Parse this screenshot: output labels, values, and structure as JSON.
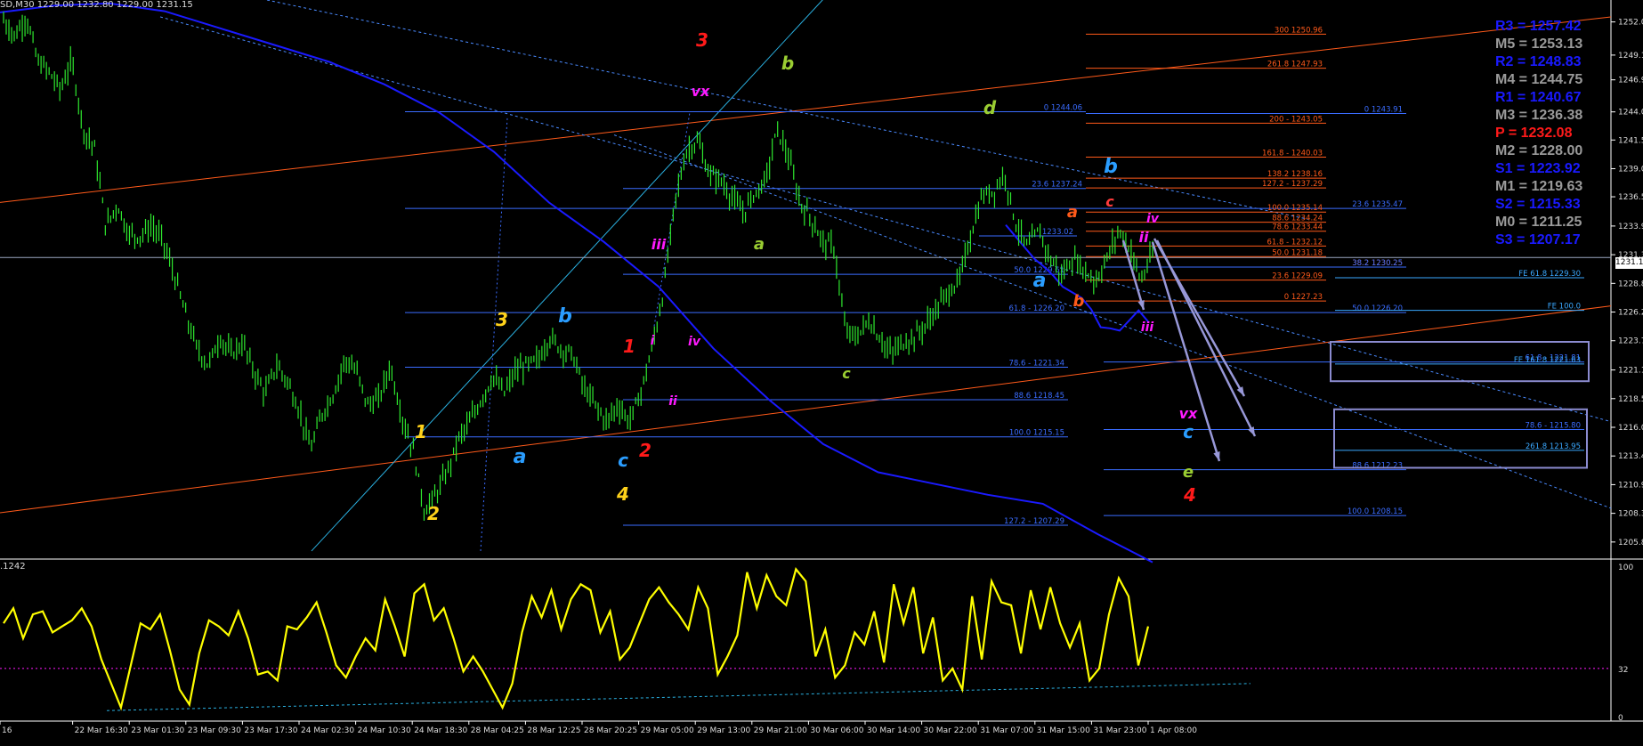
{
  "header": {
    "symbol": "SD,M30",
    "ohlc": "1229.00 1232.80 1229.00 1231.15"
  },
  "oscillator": {
    "label": ".1242"
  },
  "current_price_tag": "1231.1",
  "pivots": [
    {
      "label": "R3",
      "value": "1257.42",
      "color": "#1a1aff"
    },
    {
      "label": "M5",
      "value": "1253.13",
      "color": "#9a9a9a"
    },
    {
      "label": "R2",
      "value": "1248.83",
      "color": "#1a1aff"
    },
    {
      "label": "M4",
      "value": "1244.75",
      "color": "#9a9a9a"
    },
    {
      "label": "R1",
      "value": "1240.67",
      "color": "#1a1aff"
    },
    {
      "label": "M3",
      "value": "1236.38",
      "color": "#9a9a9a"
    },
    {
      "label": "P",
      "value": "1232.08",
      "color": "#ff1a1a"
    },
    {
      "label": "M2",
      "value": "1228.00",
      "color": "#9a9a9a"
    },
    {
      "label": "S1",
      "value": "1223.92",
      "color": "#1a1aff"
    },
    {
      "label": "M1",
      "value": "1219.63",
      "color": "#9a9a9a"
    },
    {
      "label": "S2",
      "value": "1215.33",
      "color": "#1a1aff"
    },
    {
      "label": "M0",
      "value": "1211.25",
      "color": "#9a9a9a"
    },
    {
      "label": "S3",
      "value": "1207.17",
      "color": "#1a1aff"
    }
  ],
  "chart_data": [
    {
      "type": "candlestick",
      "title": "",
      "xlabel": "",
      "ylabel": "",
      "ylim": [
        1204.6,
        1254.0
      ],
      "y_ticks": [
        "1252.05",
        "1249.10",
        "1246.90",
        "1244.05",
        "1241.55",
        "1239.00",
        "1236.50",
        "1233.90",
        "1231.35",
        "1228.80",
        "1226.25",
        "1223.70",
        "1221.10",
        "1218.55",
        "1216.00",
        "1213.45",
        "1210.90",
        "1208.35",
        "1205.80"
      ],
      "x_ticks": [
        "16",
        "22 Mar 16:30",
        "23 Mar 01:30",
        "23 Mar 09:30",
        "23 Mar 17:30",
        "24 Mar 02:30",
        "24 Mar 10:30",
        "24 Mar 18:30",
        "28 Mar 04:25",
        "28 Mar 12:25",
        "28 Mar 20:25",
        "29 Mar 05:00",
        "29 Mar 13:00",
        "29 Mar 21:00",
        "30 Mar 06:00",
        "30 Mar 14:00",
        "30 Mar 22:00",
        "31 Mar 07:00",
        "31 Mar 15:00",
        "31 Mar 23:00",
        "1 Apr 08:00"
      ],
      "price_path": [
        1252.2,
        1250.8,
        1252.5,
        1248.5,
        1247.6,
        1246.0,
        1248.6,
        1242.5,
        1240.8,
        1233.8,
        1235.8,
        1233.2,
        1233.0,
        1233.9,
        1232.6,
        1229.5,
        1226.0,
        1223.0,
        1221.5,
        1224.0,
        1222.5,
        1223.5,
        1221.0,
        1219.0,
        1221.5,
        1220.0,
        1217.5,
        1214.0,
        1217.2,
        1219.0,
        1222.0,
        1221.0,
        1218.0,
        1218.5,
        1221.5,
        1217.0,
        1214.0,
        1208.5,
        1210.0,
        1212.0,
        1215.0,
        1216.5,
        1218.5,
        1220.5,
        1219.0,
        1221.0,
        1221.5,
        1222.0,
        1224.0,
        1223.0,
        1222.5,
        1219.5,
        1218.0,
        1216.5,
        1218.0,
        1216.5,
        1219.0,
        1223.0,
        1228.0,
        1236.0,
        1240.5,
        1241.5,
        1238.5,
        1238.0,
        1236.5,
        1235.0,
        1236.8,
        1238.0,
        1242.5,
        1240.0,
        1236.0,
        1234.5,
        1232.5,
        1232.0,
        1224.5,
        1224.0,
        1225.5,
        1224.0,
        1222.5,
        1223.5,
        1224.0,
        1225.0,
        1226.5,
        1228.0,
        1229.0,
        1233.0,
        1236.5,
        1237.0,
        1238.5,
        1234.0,
        1232.0,
        1233.5,
        1231.0,
        1229.5,
        1231.0,
        1230.0,
        1229.0,
        1231.0,
        1233.5,
        1232.0,
        1229.0,
        1231.5
      ],
      "moving_averages": [
        {
          "name": "",
          "color": "#1a1aff",
          "values": [
            1252.9,
            1253.5,
            1253.7,
            1253.0,
            1251.5,
            1250.0,
            1248.5,
            1246.5,
            1244.0,
            1240.5,
            1236.0,
            1232.5,
            1228.5,
            1223.0,
            1218.5,
            1214.5,
            1212.0,
            1211.0,
            1210.0,
            1209.2,
            1206.5,
            1204.0
          ]
        },
        {
          "name": "",
          "color": "#1a1aff",
          "values": [
            1234.0,
            1233.0,
            1232.0,
            1231.0,
            1230.3,
            1229.5,
            1228.5,
            1228.0,
            1227.5,
            1226.5,
            1224.9,
            1224.8,
            1224.6,
            1225.5,
            1226.4,
            1225.4
          ]
        }
      ],
      "fib_levels": [
        {
          "label": "300 1250.96",
          "value": 1250.96,
          "color": "#ff5a1a"
        },
        {
          "label": "261.8 1247.93",
          "value": 1247.93,
          "color": "#ff5a1a"
        },
        {
          "label": "0 1244.06",
          "value": 1244.06,
          "color": "#3a6cff"
        },
        {
          "label": "200 - 1243.05",
          "value": 1243.05,
          "color": "#ff5a1a"
        },
        {
          "label": "0 1243.91",
          "value": 1243.91,
          "color": "#3a6cff"
        },
        {
          "label": "161.8 - 1240.03",
          "value": 1240.03,
          "color": "#ff5a1a"
        },
        {
          "label": "138.2 1238.16",
          "value": 1238.16,
          "color": "#ff5a1a"
        },
        {
          "label": "23.6 1237.24",
          "value": 1237.24,
          "color": "#3a6cff"
        },
        {
          "label": "127.2 - 1237.29",
          "value": 1237.29,
          "color": "#ff5a1a"
        },
        {
          "label": "23.6 1235.47",
          "value": 1235.47,
          "color": "#3a6cff"
        },
        {
          "label": "100.0 1235.14",
          "value": 1235.14,
          "color": "#ff5a1a"
        },
        {
          "label": "88.6 1234.24",
          "value": 1234.24,
          "color": "#ff5a1a"
        },
        {
          "label": "78.6 1233.44",
          "value": 1233.44,
          "color": "#ff5a1a"
        },
        {
          "label": "1233.02",
          "value": 1233.02,
          "color": "#3a6cff"
        },
        {
          "label": "61.8 - 1232.12",
          "value": 1232.12,
          "color": "#ff5a1a"
        },
        {
          "label": "50.0 1231.18",
          "value": 1231.18,
          "color": "#ff5a1a"
        },
        {
          "label": "38.2 1230.25",
          "value": 1230.25,
          "color": "#ff5a1a"
        },
        {
          "label": "38.2 1230.25",
          "value": 1230.25,
          "color": "#3a6cff"
        },
        {
          "label": "50.0 1229.61",
          "value": 1229.61,
          "color": "#3a6cff"
        },
        {
          "label": "FE 61.8 1229.30",
          "value": 1229.3,
          "color": "#3aa8ff"
        },
        {
          "label": "23.6 1229.09",
          "value": 1229.09,
          "color": "#ff5a1a"
        },
        {
          "label": "0 1227.23",
          "value": 1227.23,
          "color": "#ff5a1a"
        },
        {
          "label": "61.8 - 1226.20",
          "value": 1226.2,
          "color": "#3a6cff"
        },
        {
          "label": "50.0 1226.20",
          "value": 1226.2,
          "color": "#3a6cff"
        },
        {
          "label": "FE 100.0",
          "value": 1226.4,
          "color": "#3aa8ff"
        },
        {
          "label": "61.8 - 1221.81",
          "value": 1221.81,
          "color": "#3a6cff"
        },
        {
          "label": "FE 161.8 1221.63",
          "value": 1221.63,
          "color": "#3aa8ff"
        },
        {
          "label": "78.6 - 1221.34",
          "value": 1221.34,
          "color": "#3a6cff"
        },
        {
          "label": "88.6 1218.45",
          "value": 1218.45,
          "color": "#3a6cff"
        },
        {
          "label": "78.6 - 1215.80",
          "value": 1215.8,
          "color": "#3a6cff"
        },
        {
          "label": "100.0 1215.15",
          "value": 1215.15,
          "color": "#3a6cff"
        },
        {
          "label": "261.8 1213.95",
          "value": 1213.95,
          "color": "#3aa8ff"
        },
        {
          "label": "88.6 1212.23",
          "value": 1212.23,
          "color": "#3a6cff"
        },
        {
          "label": "100.0 1208.15",
          "value": 1208.15,
          "color": "#3a6cff"
        },
        {
          "label": "127.2 - 1207.29",
          "value": 1207.29,
          "color": "#3a6cff"
        }
      ],
      "wave_labels": [
        {
          "text": "3",
          "color": "#ff1a1a"
        },
        {
          "text": "b",
          "color": "#9acd32"
        },
        {
          "text": "vx",
          "color": "#ff1aff"
        },
        {
          "text": "d",
          "color": "#9acd32"
        },
        {
          "text": "b",
          "color": "#2a9dff"
        },
        {
          "text": "c",
          "color": "#ff3a3a"
        },
        {
          "text": "a",
          "color": "#ff5a1a"
        },
        {
          "text": "iv",
          "color": "#ff1aff"
        },
        {
          "text": "ii",
          "color": "#ff1aff"
        },
        {
          "text": "iii",
          "color": "#ff1aff"
        },
        {
          "text": "a",
          "color": "#9acd32"
        },
        {
          "text": "a",
          "color": "#2a9dff"
        },
        {
          "text": "b",
          "color": "#ff5a1a"
        },
        {
          "text": "iii",
          "color": "#ff1aff"
        },
        {
          "text": "3",
          "color": "#ffd21a"
        },
        {
          "text": "b",
          "color": "#2a9dff"
        },
        {
          "text": "1",
          "color": "#ff1a1a"
        },
        {
          "text": "i",
          "color": "#ff1aff"
        },
        {
          "text": "iv",
          "color": "#ff1aff"
        },
        {
          "text": "c",
          "color": "#9acd32"
        },
        {
          "text": "ii",
          "color": "#ff1aff"
        },
        {
          "text": "vx",
          "color": "#ff1aff"
        },
        {
          "text": "c",
          "color": "#2a9dff"
        },
        {
          "text": "1",
          "color": "#ffd21a"
        },
        {
          "text": "a",
          "color": "#2a9dff"
        },
        {
          "text": "c",
          "color": "#2a9dff"
        },
        {
          "text": "2",
          "color": "#ff1a1a"
        },
        {
          "text": "e",
          "color": "#9acd32"
        },
        {
          "text": "4",
          "color": "#ff1a1a"
        },
        {
          "text": "2",
          "color": "#ffd21a"
        },
        {
          "text": "4",
          "color": "#ffd21a"
        }
      ]
    },
    {
      "type": "line",
      "title": "",
      "ylim": [
        0,
        100
      ],
      "y_ticks": [
        "100",
        "32",
        "0"
      ],
      "reference_level": 32,
      "series": [
        {
          "name": "",
          "color": "#ffff00",
          "values": [
            62,
            72,
            52,
            68,
            70,
            56,
            60,
            64,
            72,
            60,
            38,
            22,
            6,
            34,
            62,
            58,
            68,
            44,
            18,
            8,
            42,
            64,
            60,
            54,
            70,
            52,
            28,
            30,
            24,
            60,
            58,
            66,
            76,
            56,
            34,
            26,
            40,
            52,
            44,
            78,
            60,
            40,
            82,
            88,
            64,
            72,
            52,
            30,
            40,
            30,
            18,
            6,
            22,
            56,
            80,
            66,
            84,
            58,
            78,
            88,
            84,
            56,
            70,
            38,
            46,
            62,
            78,
            86,
            76,
            68,
            58,
            86,
            72,
            28,
            40,
            54,
            96,
            72,
            94,
            80,
            74,
            98,
            90,
            40,
            58,
            26,
            34,
            56,
            48,
            70,
            36,
            88,
            62,
            86,
            42,
            66,
            24,
            32,
            18,
            80,
            38,
            90,
            76,
            74,
            42,
            84,
            58,
            86,
            62,
            46,
            62,
            24,
            32,
            68,
            92,
            80,
            34,
            60
          ]
        }
      ]
    }
  ]
}
